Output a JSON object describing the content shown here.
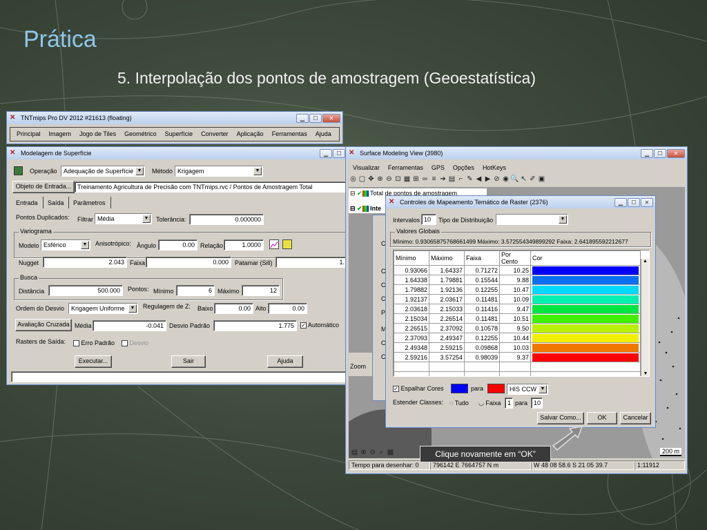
{
  "slide": {
    "title": "Prática",
    "subtitle": "5. Interpolação dos pontos de amostragem (Geoestatística)"
  },
  "colors": {
    "title": "#8ec7ec",
    "accent_blue": "#0000ff",
    "accent_red": "#ff0000"
  },
  "main_window": {
    "title": "TNTmips Pro DV 2012  #21613 (floating)",
    "menu": [
      "Principal",
      "Imagem",
      "Jogo de Tiles",
      "Geométrico",
      "Superfície",
      "Converter",
      "Aplicação",
      "Ferramentas",
      "Ajuda"
    ]
  },
  "surface_modeling": {
    "title": "Modelagem de Superfície",
    "operacao_label": "Operação",
    "operacao_value": "Adequação de Superfície",
    "metodo_label": "Método",
    "metodo_value": "Krigagem",
    "object_button": "Objeto de Entrada...",
    "object_path": "Treinamento Agricultura de Precisão com TNTmips.rvc / Pontos de Amostragem Total",
    "tabs": [
      "Entrada",
      "Saída",
      "Parâmetros"
    ],
    "pontos_dup_label": "Pontos Duplicados:",
    "filtrar_label": "Filtrar",
    "filtrar_value": "Média",
    "tolerancia_label": "Tolerância:",
    "tolerancia_value": "0.000000",
    "variograma_label": "Variograma",
    "modelo_label": "Modelo",
    "modelo_value": "Esférico",
    "anisotropico_label": "Anisotrópico:",
    "angulo_label": "Ângulo",
    "angulo_value": "0.00",
    "relacao_label": "Relação",
    "relacao_value": "1.0000",
    "nugget_label": "Nugget",
    "nugget_value": "2.043",
    "faixa_label": "Faixa",
    "faixa_value": "0.000",
    "patamar_label": "Patamar (Sill)",
    "patamar_value": "1.",
    "busca_label": "Busca",
    "distancia_label": "Distância",
    "distancia_value": "500.000",
    "pontos_label": "Pontos:",
    "minimo_label": "Mínimo",
    "minimo_value": "6",
    "maximo_label": "Máximo",
    "maximo_value": "12",
    "ordem_label": "Ordem do Desvio",
    "ordem_value": "Krigagem Uniforme",
    "regulagem_label": "Regulagem de Z:",
    "baixo_label": "Baixo",
    "baixo_value": "0.00",
    "alto_label": "Alto",
    "alto_value": "0.00",
    "avaliacao_button": "Avaliação Cruzada",
    "media_label": "Média",
    "media_value": "-0.041",
    "desvio_padrao_label": "Desvio Padrão",
    "desvio_padrao_value": "1.775",
    "automatico_label": "Automático",
    "rasters_label": "Rasters de Saída:",
    "erro_padrao_label": "Erro Padrão",
    "desvio_label": "Desvio",
    "executar_button": "Executar...",
    "sair_button": "Sair",
    "ajuda_button": "Ajuda"
  },
  "surface_view": {
    "title": "Surface Modeling View (3980)",
    "menu": [
      "Visualizar",
      "Ferramentas",
      "GPS",
      "Opções",
      "HotKeys"
    ],
    "layer1": "Total de pontos de amostragem",
    "layer2": "Inte",
    "zoom_label": "Zoom",
    "scale_label": "200 m",
    "status_label": "Tempo para desenhar: 0",
    "coords": "796142 E  7664757 N m",
    "latlon": "W 48 08 58.6  S 21 05 39.7",
    "scale_ratio": "1:11912"
  },
  "thematic": {
    "title": "Controles de Mapeamento Temático de Raster (2376)",
    "intervalos_label": "Intervalos",
    "intervalos_value": "10",
    "tipo_label": "Tipo de Distribuição",
    "valores_globais_label": "Valores Globais",
    "global_stats": "Mínimo: 0.93065875768661499  Máximo: 3.572554349899292  Faixa: 2.641895592212677",
    "columns": [
      "Mínimo",
      "Máximo",
      "Faixa",
      "Por Cento",
      "Cor"
    ],
    "rows": [
      {
        "min": "0.93066",
        "max": "1.64337",
        "range": "0.71272",
        "pct": "10.25",
        "color": "#0000ff"
      },
      {
        "min": "1.64338",
        "max": "1.79881",
        "range": "0.15544",
        "pct": "9.88",
        "color": "#0a6ff0"
      },
      {
        "min": "1.79882",
        "max": "1.92136",
        "range": "0.12255",
        "pct": "10.47",
        "color": "#00d8ff"
      },
      {
        "min": "1.92137",
        "max": "2.03617",
        "range": "0.11481",
        "pct": "10.09",
        "color": "#00f0b0"
      },
      {
        "min": "2.03618",
        "max": "2.15033",
        "range": "0.11416",
        "pct": "9.47",
        "color": "#00e640"
      },
      {
        "min": "2.15034",
        "max": "2.26514",
        "range": "0.11481",
        "pct": "10.51",
        "color": "#40f000"
      },
      {
        "min": "2.26515",
        "max": "2.37092",
        "range": "0.10578",
        "pct": "9.50",
        "color": "#b8f000"
      },
      {
        "min": "2.37093",
        "max": "2.49347",
        "range": "0.12255",
        "pct": "10.44",
        "color": "#f0f000"
      },
      {
        "min": "2.49348",
        "max": "2.59215",
        "range": "0.09868",
        "pct": "10.03",
        "color": "#f07800"
      },
      {
        "min": "2.59216",
        "max": "3.57254",
        "range": "0.98039",
        "pct": "9.37",
        "color": "#ff0000"
      }
    ],
    "espalhar_label": "Espalhar Cores",
    "para_label": "para",
    "scheme_value": "HIS CCW",
    "estender_label": "Estender Classes:",
    "tudo_label": "Tudo",
    "faixa_label": "Faixa",
    "faixa_from": "1",
    "para2_label": "para",
    "faixa_to": "10",
    "salvar_button": "Salvar Como...",
    "ok_button": "OK",
    "cancelar_button": "Cancelar"
  },
  "callout": "Clique novamente em “OK”"
}
